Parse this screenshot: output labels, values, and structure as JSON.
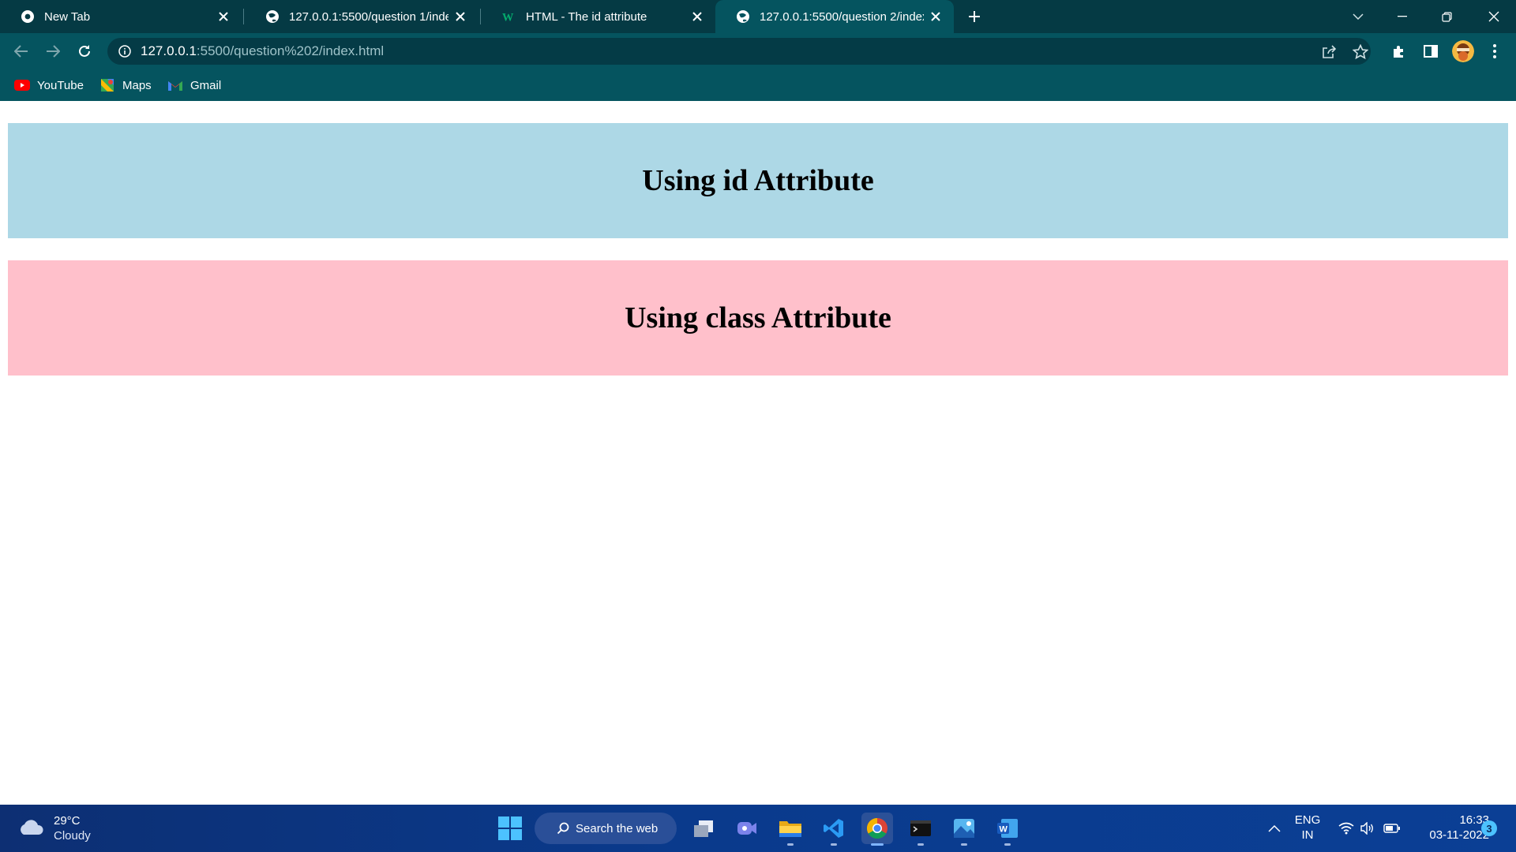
{
  "browser": {
    "tabs": [
      {
        "title": "New Tab",
        "favicon": "chrome-icon",
        "active": false
      },
      {
        "title": "127.0.0.1:5500/question 1/index.h",
        "favicon": "globe-icon",
        "active": false
      },
      {
        "title": "HTML - The id attribute",
        "favicon": "w3schools-icon",
        "active": false
      },
      {
        "title": "127.0.0.1:5500/question 2/index.h",
        "favicon": "globe-icon",
        "active": true
      }
    ],
    "address_bar": {
      "host": "127.0.0.1",
      "path": ":5500/question%202/index.html"
    },
    "bookmarks": [
      {
        "label": "YouTube",
        "icon": "youtube-icon"
      },
      {
        "label": "Maps",
        "icon": "maps-icon"
      },
      {
        "label": "Gmail",
        "icon": "gmail-icon"
      }
    ]
  },
  "page": {
    "id_heading": "Using id Attribute",
    "class_heading": "Using class Attribute",
    "colors": {
      "id_box": "#add8e6",
      "class_box": "#ffc0cb"
    }
  },
  "taskbar": {
    "weather": {
      "temp": "29°C",
      "condition": "Cloudy"
    },
    "search_label": "Search the web",
    "apps": [
      "task-view-icon",
      "teams-icon",
      "file-explorer-icon",
      "vscode-icon",
      "chrome-icon",
      "terminal-icon",
      "photos-icon",
      "word-icon"
    ],
    "language": {
      "line1": "ENG",
      "line2": "IN"
    },
    "clock": {
      "time": "16:33",
      "date": "03-11-2022"
    },
    "notification_count": "3"
  }
}
